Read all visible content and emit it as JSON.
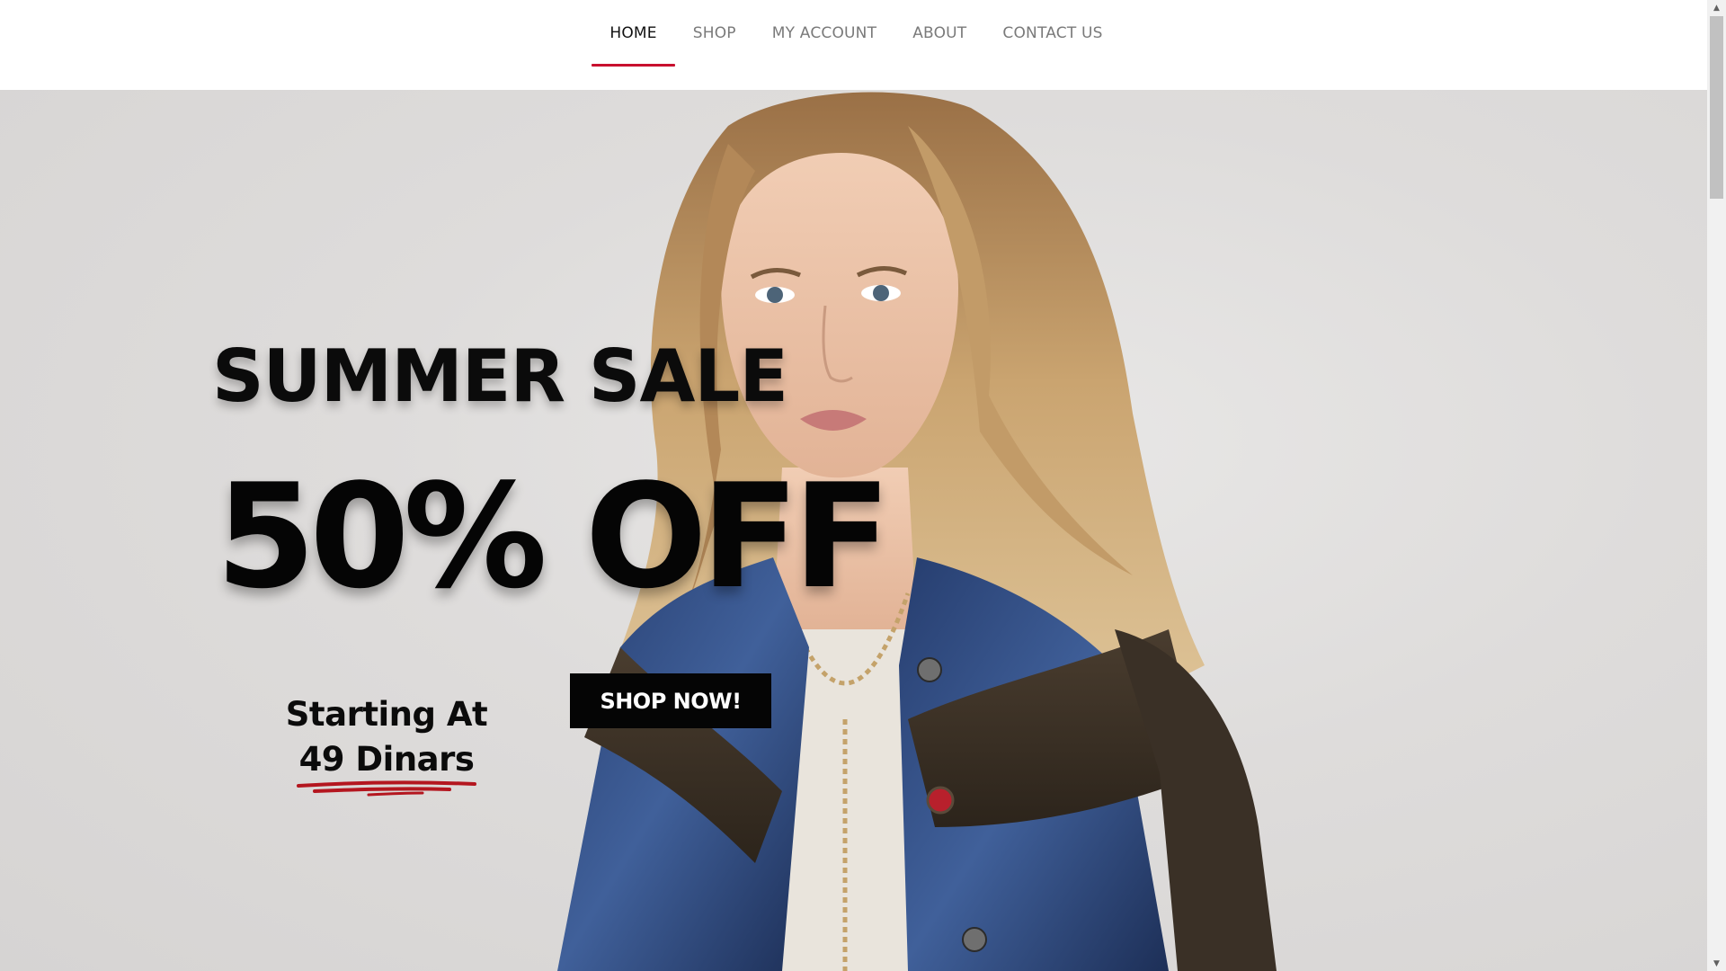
{
  "nav": {
    "items": [
      {
        "label": "HOME",
        "active": true
      },
      {
        "label": "SHOP",
        "active": false
      },
      {
        "label": "MY ACCOUNT",
        "active": false
      },
      {
        "label": "ABOUT",
        "active": false
      },
      {
        "label": "CONTACT US",
        "active": false
      }
    ],
    "active_color": "#c8102e"
  },
  "hero": {
    "title": "SUMMER SALE",
    "discount": "50% OFF",
    "starting_label": "Starting At",
    "price": "49 Dinars",
    "cta_label": "SHOP NOW!",
    "image": "model-in-denim-and-leather-jacket"
  },
  "colors": {
    "accent": "#c8102e",
    "text": "#0b0b0b",
    "cta_bg": "#050505",
    "cta_text": "#ffffff",
    "hero_bg": "#dedcdb"
  }
}
